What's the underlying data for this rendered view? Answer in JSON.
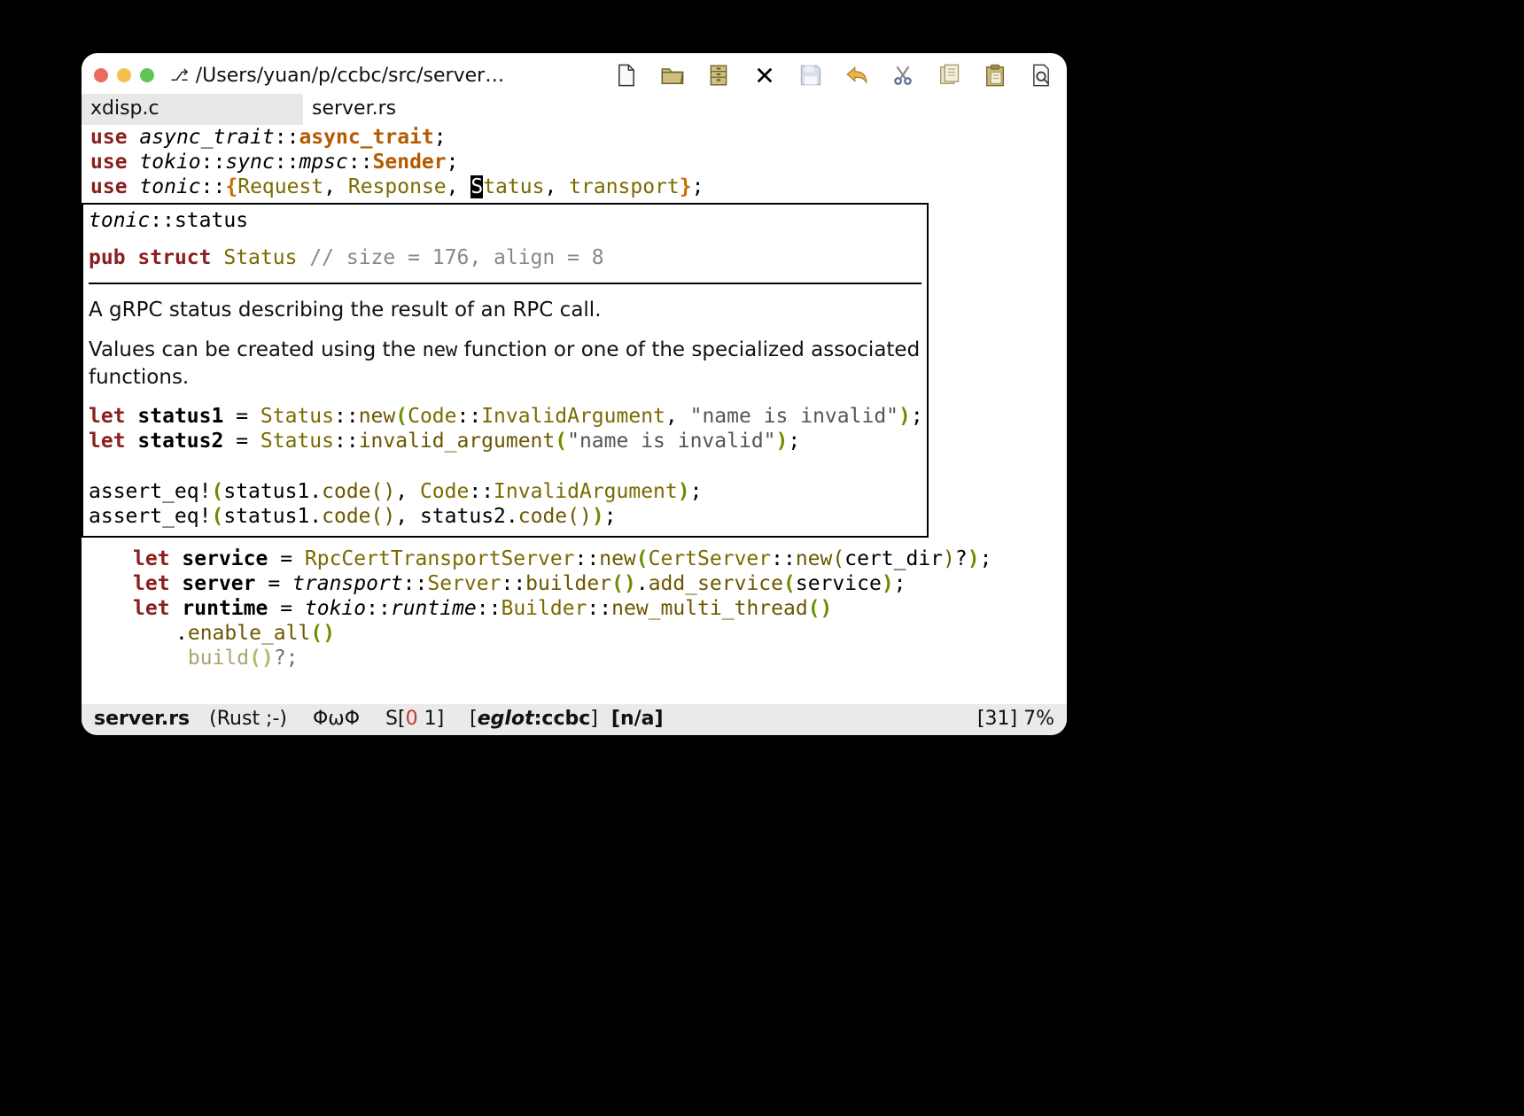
{
  "window": {
    "title_path": "/Users/yuan/p/ccbc/src/server…",
    "branch_glyph": "⎇"
  },
  "traffic_colors": {
    "close": "#ed6a5e",
    "min": "#f5bf4f",
    "max": "#61c554"
  },
  "tabs": [
    {
      "label": "xdisp.c",
      "active": true
    },
    {
      "label": "server.rs",
      "active": false
    }
  ],
  "code_top": {
    "l1": {
      "use": "use",
      "mod": "async_trait",
      "sym": "async_trait",
      "sep": "::",
      "semi": ";"
    },
    "l2": {
      "use": "use",
      "p1": "tokio",
      "p2": "sync",
      "p3": "mpsc",
      "sym": "Sender",
      "sep": "::",
      "semi": ";"
    },
    "l3": {
      "use": "use",
      "mod": "tonic",
      "sep": "::",
      "ob": "{",
      "a": "Request",
      "b": "Response",
      "c_pre": "S",
      "c_rest": "tatus",
      "d": "transport",
      "cb": "}",
      "comma": ", ",
      "semi": ";"
    }
  },
  "popup": {
    "head_mod": "tonic",
    "head_sep": "::",
    "head_sub": "status",
    "sig_pub": "pub",
    "sig_struct": "struct",
    "sig_name": "Status",
    "sig_comment": "// size = 176, align = 8",
    "desc1": "A gRPC status describing the result of an RPC call.",
    "desc2a": "Values can be created using the ",
    "desc2_code": "new",
    "desc2b": " function or one of the specialized associated functions.",
    "ex": {
      "let": "let",
      "s1": "status1",
      "s2": "status2",
      "eq": " = ",
      "Status": "Status",
      "dcolon": "::",
      "new": "new",
      "Code": "Code",
      "InvalidArgument": "InvalidArgument",
      "str": "\"name is invalid\"",
      "semi": ";",
      "invalid_argument": "invalid_argument",
      "assert_eq": "assert_eq!",
      "code_call": "code",
      "op": "(",
      "cp": ")",
      "comma": ", ",
      "status2": "status2"
    }
  },
  "code_below": {
    "l1": {
      "let": "let",
      "name": "service",
      "eq": " = ",
      "T1": "RpcCertTransportServer",
      "dc": "::",
      "new": "new",
      "T2": "CertServer",
      "arg": "cert_dir",
      "q": "?",
      "semi": ";"
    },
    "l2": {
      "let": "let",
      "name": "server",
      "eq": " = ",
      "mod": "transport",
      "dc": "::",
      "T": "Server",
      "b": "builder",
      "m": "add_service",
      "arg": "service",
      "semi": ";"
    },
    "l3": {
      "let": "let",
      "name": "runtime",
      "eq": " = ",
      "mod1": "tokio",
      "mod2": "runtime",
      "T": "Builder",
      "m": "new_multi_thread",
      "dc": "::",
      "semi": ""
    },
    "l4": {
      "dot": ".",
      "m": "enable_all"
    },
    "l5": {
      "dot": "",
      "m": "build",
      "q": "?",
      "semi": ";"
    }
  },
  "modeline": {
    "filename": "server.rs",
    "mode": "(Rust ;-)",
    "flycheck": "ΦωΦ",
    "s_label": "S[",
    "s_err": "0",
    "s_warn": "1",
    "s_close": "]",
    "eglot_open": "[",
    "eglot_label": "eglot",
    "eglot_sep": ":",
    "eglot_proj": "ccbc",
    "eglot_close": "]",
    "na": "[n/a]",
    "pos": "[31] 7%"
  }
}
